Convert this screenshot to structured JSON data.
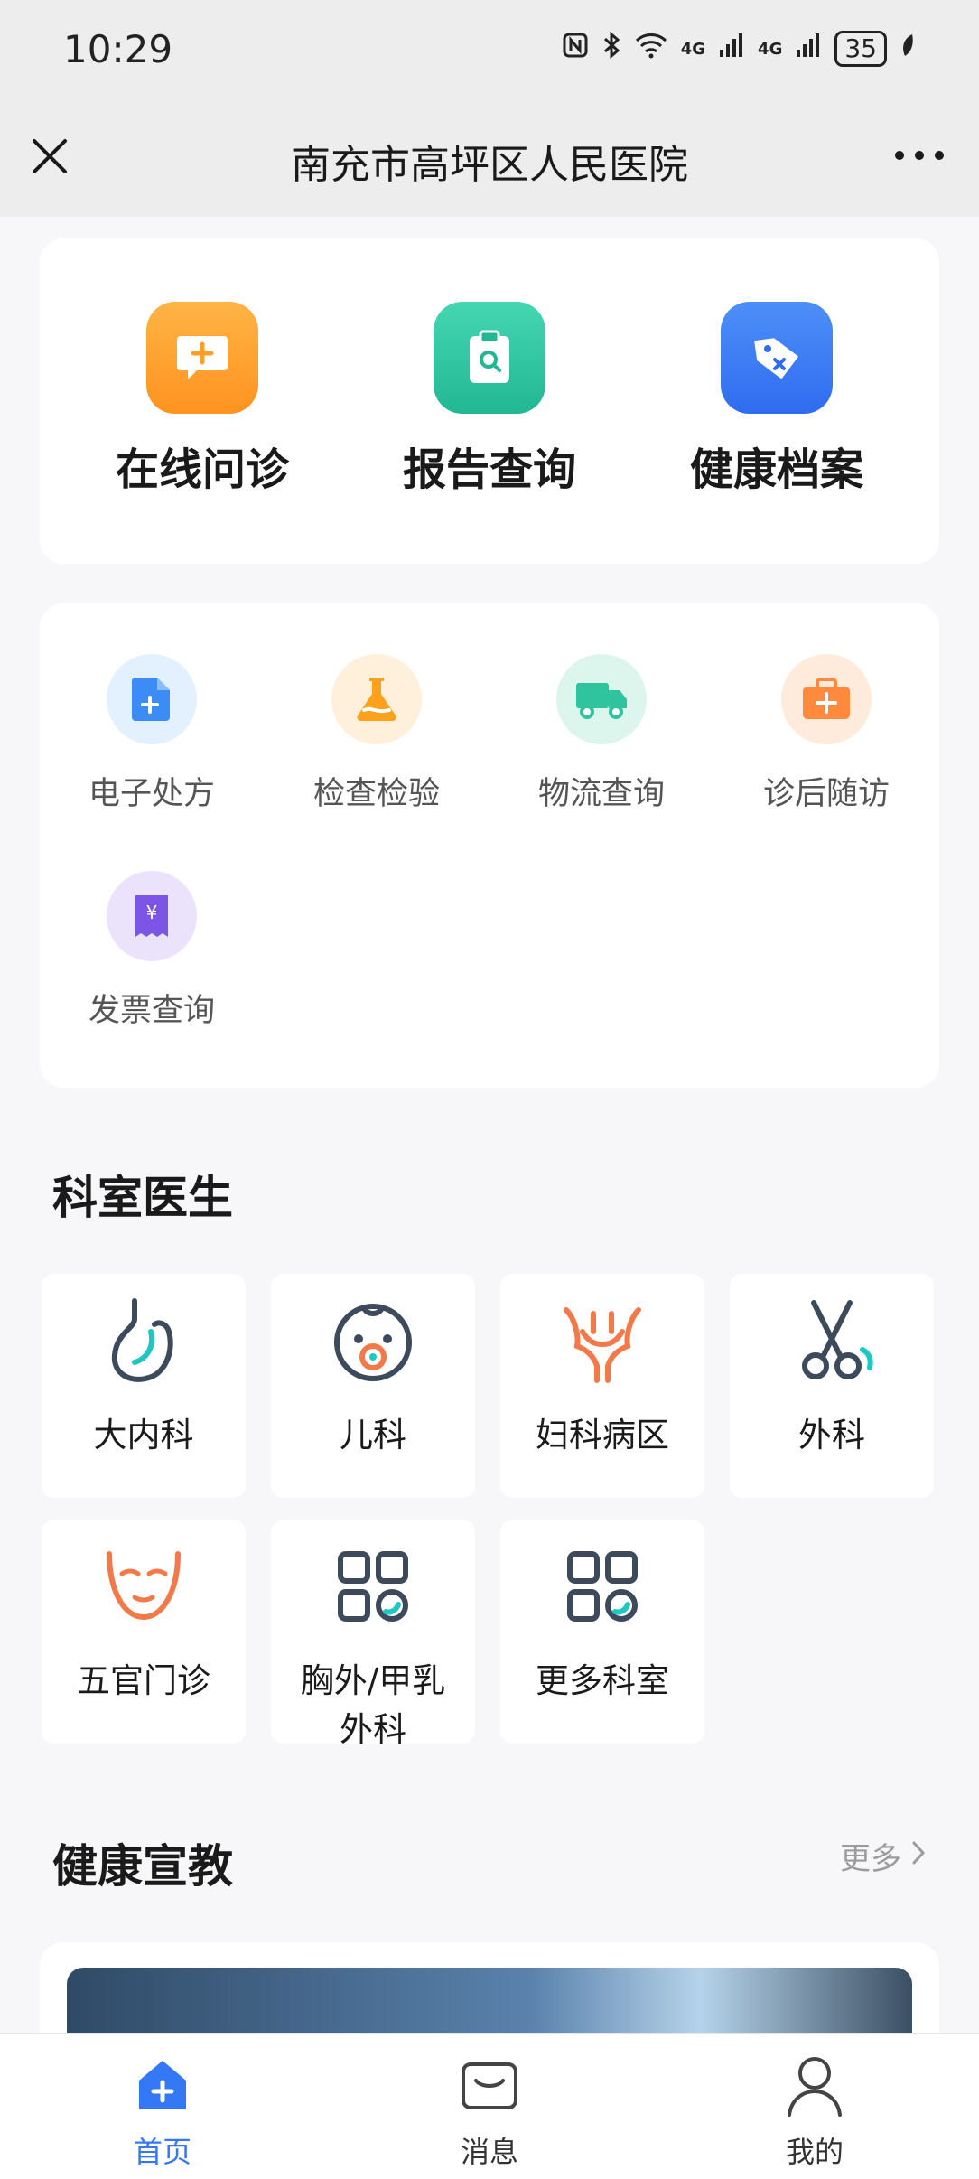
{
  "status_bar": {
    "time": "10:29",
    "network_1": "4G",
    "network_2": "4G",
    "battery": "35"
  },
  "nav": {
    "title": "南充市高坪区人民医院"
  },
  "primary_services": [
    {
      "label": "在线问诊",
      "icon": "chat-plus-icon",
      "color": "#ff9f2a"
    },
    {
      "label": "报告查询",
      "icon": "clipboard-search-icon",
      "color": "#2ec4a2"
    },
    {
      "label": "健康档案",
      "icon": "tag-icon",
      "color": "#3478f6"
    }
  ],
  "services": [
    {
      "label": "电子处方",
      "icon": "prescription-doc-icon",
      "color": "#3b8cf5",
      "bg": "#e3f0fe"
    },
    {
      "label": "检查检验",
      "icon": "flask-icon",
      "color": "#ffa11c",
      "bg": "#fff0dc"
    },
    {
      "label": "物流查询",
      "icon": "truck-icon",
      "color": "#2fc39e",
      "bg": "#dcf6ee"
    },
    {
      "label": "诊后随访",
      "icon": "medkit-icon",
      "color": "#ff8a3d",
      "bg": "#ffebdc"
    },
    {
      "label": "发票查询",
      "icon": "invoice-icon",
      "color": "#7d55e6",
      "bg": "#ebe3fb"
    }
  ],
  "departments_section": {
    "title": "科室医生"
  },
  "departments": [
    {
      "label": "大内科",
      "icon": "stomach-icon"
    },
    {
      "label": "儿科",
      "icon": "baby-icon"
    },
    {
      "label": "妇科病区",
      "icon": "uterus-icon"
    },
    {
      "label": "外科",
      "icon": "scissors-icon"
    },
    {
      "label": "五官门诊",
      "icon": "face-icon"
    },
    {
      "label": "胸外/甲乳外科",
      "label_line1": "胸外/甲乳",
      "label_line2": "外科",
      "icon": "grid-apps-icon"
    },
    {
      "label": "更多科室",
      "icon": "grid-apps-icon"
    }
  ],
  "health_section": {
    "title": "健康宣教",
    "more": "更多"
  },
  "tabs": [
    {
      "label": "首页",
      "icon": "home-plus-icon",
      "active": true
    },
    {
      "label": "消息",
      "icon": "message-icon",
      "active": false
    },
    {
      "label": "我的",
      "icon": "user-icon",
      "active": false
    }
  ],
  "colors": {
    "accent": "#3478f6",
    "dept_icon_dark": "#3d4a5c",
    "dept_icon_orange": "#f27a4a",
    "dept_icon_teal": "#1fc7c1"
  }
}
